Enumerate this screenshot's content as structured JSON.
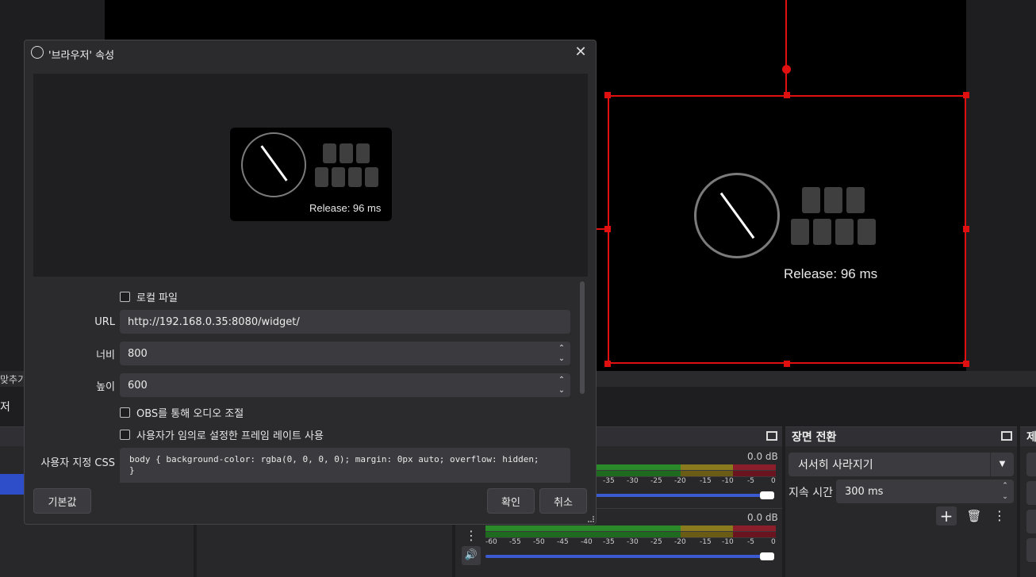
{
  "dialog": {
    "title": "'브라우저' 속성",
    "preview_release": "Release: 96 ms",
    "local_file_label": "로컬 파일",
    "url_label": "URL",
    "url_value": "http://192.168.0.35:8080/widget/",
    "width_label": "너비",
    "width_value": "800",
    "height_label": "높이",
    "height_value": "600",
    "obs_audio_label": "OBS를 통해 오디오 조절",
    "custom_fps_label": "사용자가 임의로 설정한 프레임 레이트 사용",
    "css_label": "사용자 지정 CSS",
    "css_value_line1": "body { background-color: rgba(0, 0, 0, 0); margin: 0px auto; overflow: hidden;",
    "css_value_line2": "}",
    "defaults_button": "기본값",
    "ok_button": "확인",
    "cancel_button": "취소"
  },
  "scene_preview": {
    "release_text": "Release: 96 ms"
  },
  "left_panel": {
    "fit_label": "맞추기",
    "browser_label": "저"
  },
  "audio_mixer": {
    "track1_db": "0.0 dB",
    "track2_db": "0.0 dB",
    "ticks": [
      "-60",
      "-55",
      "-50",
      "-45",
      "-40",
      "-35",
      "-30",
      "-25",
      "-20",
      "-15",
      "-10",
      "-5",
      "0"
    ]
  },
  "transitions": {
    "header": "장면 전환",
    "transition_value": "서서히 사라지기",
    "duration_label": "지속 시간",
    "duration_value": "300 ms"
  },
  "controls": {
    "header": "제"
  }
}
